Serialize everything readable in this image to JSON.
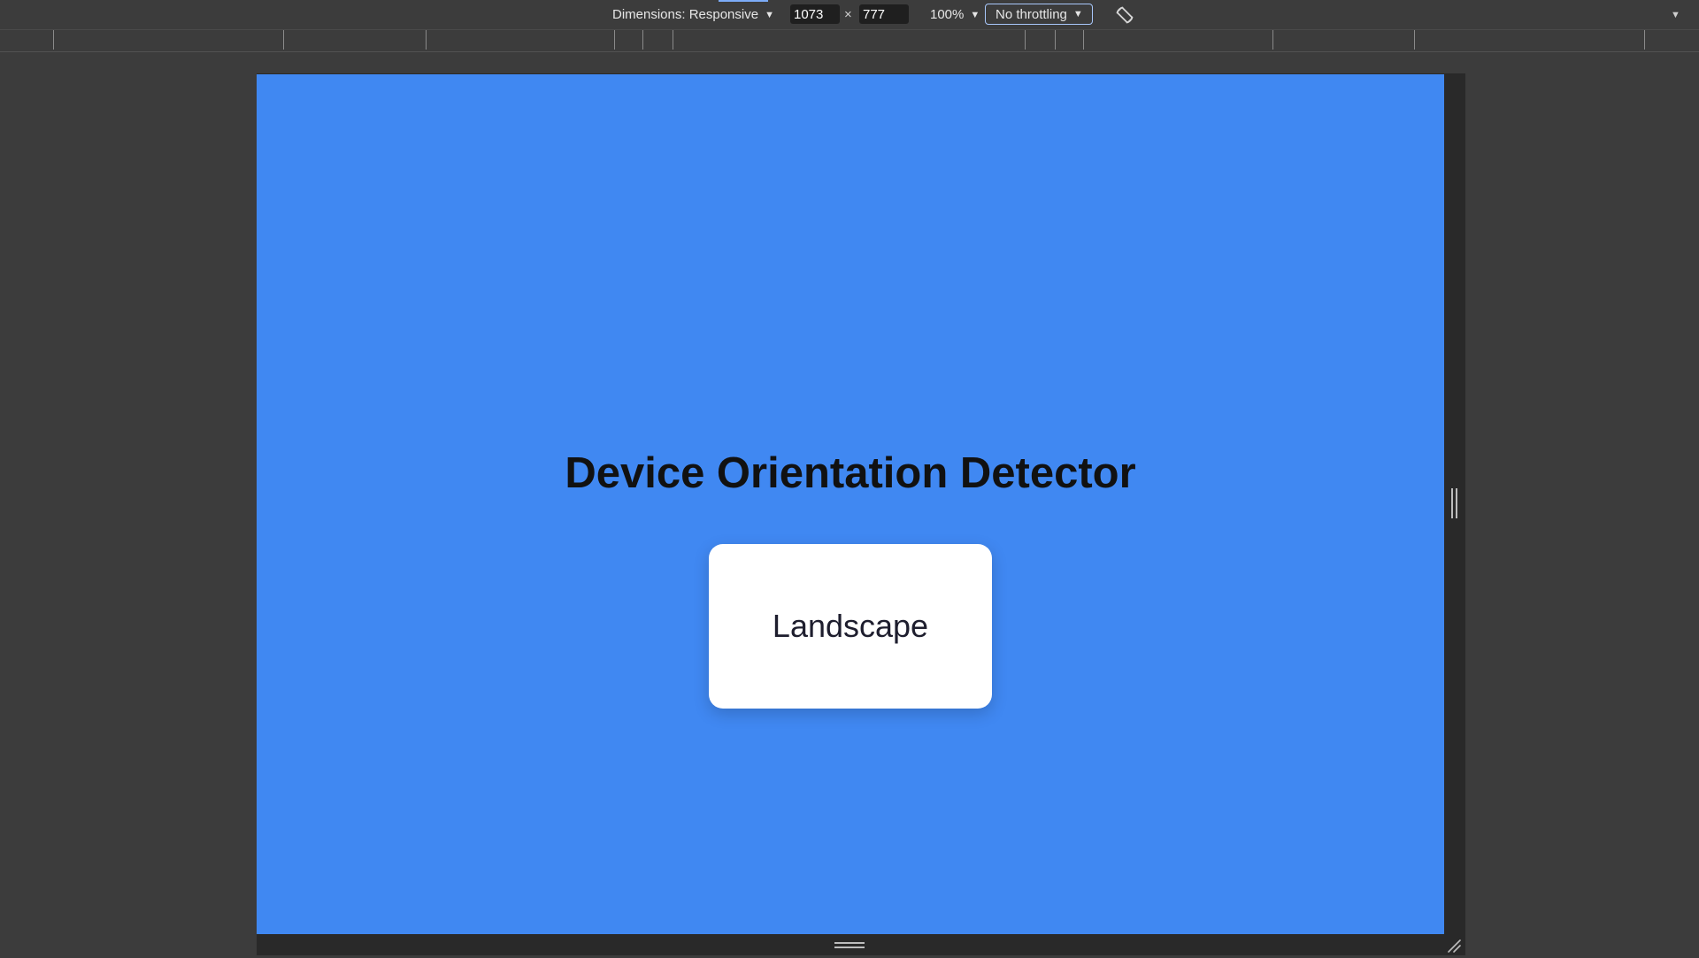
{
  "devtools": {
    "dimensions_label": "Dimensions: Responsive",
    "width_value": "1073",
    "height_value": "777",
    "times_symbol": "×",
    "zoom_label": "100%",
    "throttling_label": "No throttling",
    "accent_color": "#a8c7fa",
    "icons": {
      "rotate": "rotate-icon",
      "more": "chevron-down-icon"
    }
  },
  "page": {
    "background_color": "#4088f2",
    "title": "Device Orientation Detector",
    "orientation": "Landscape"
  }
}
